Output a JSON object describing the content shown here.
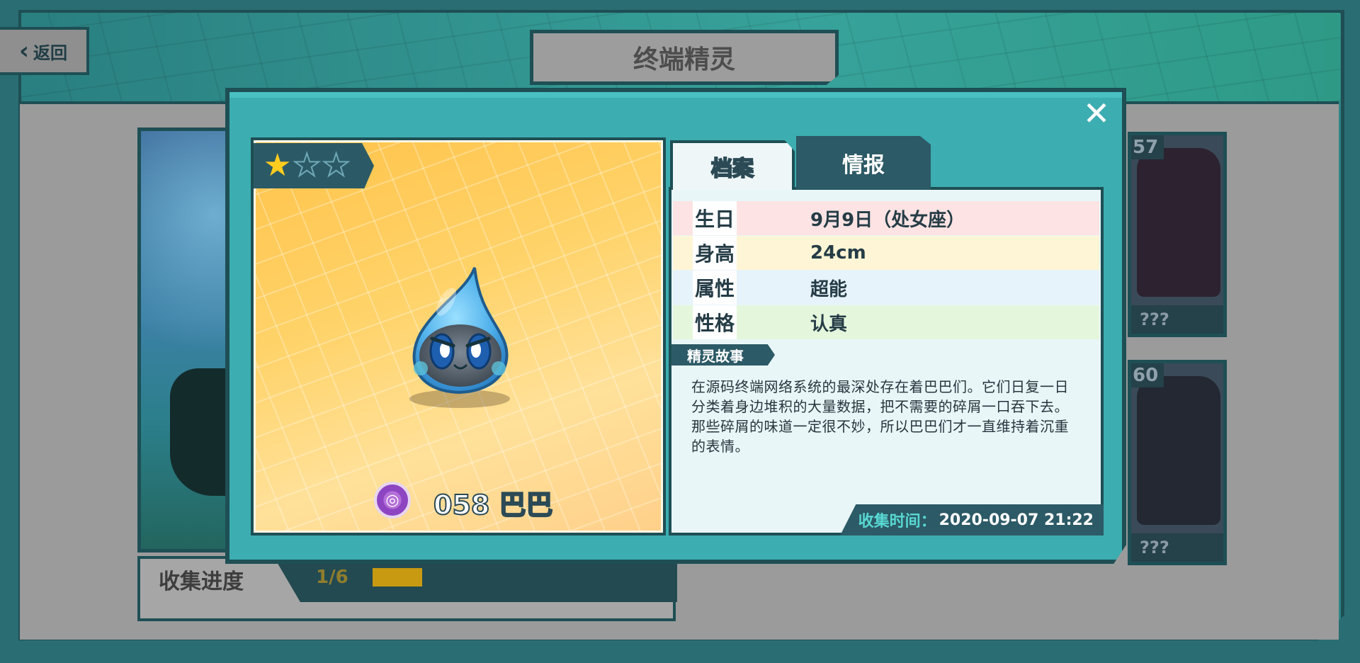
{
  "header": {
    "back_label": "返回",
    "title": "终端精灵"
  },
  "collection": {
    "progress_label": "收集进度",
    "progress_count": "1/6",
    "progress_fraction": 0.1667
  },
  "side_cards": [
    {
      "number": "57",
      "name": "???"
    },
    {
      "number": "60",
      "name": "???"
    }
  ],
  "modal": {
    "close_icon": "close-icon",
    "stars": {
      "filled": 1,
      "total": 3
    },
    "creature": {
      "number_name": "058 巴巴",
      "element_icon": "psychic-element-icon",
      "element_color": "#9b55cc"
    },
    "tabs": [
      {
        "label": "档案",
        "active": true
      },
      {
        "label": "情报",
        "active": false
      }
    ],
    "profile": [
      {
        "key": "生日",
        "value": "9月9日（处女座）",
        "color": "#fde3e3"
      },
      {
        "key": "身高",
        "value": "24cm",
        "color": "#fdf5d5"
      },
      {
        "key": "属性",
        "value": "超能",
        "color": "#e6f3fb"
      },
      {
        "key": "性格",
        "value": "认真",
        "color": "#e4f7dc"
      }
    ],
    "story_title": "精灵故事",
    "story_text": "在源码终端网络系统的最深处存在着巴巴们。它们日复一日分类着身边堆积的大量数据，把不需要的碎屑一口吞下去。那些碎屑的味道一定很不妙，所以巴巴们才一直维持着沉重的表情。",
    "collect_time_label": "收集时间：",
    "collect_time_value": "2020-09-07 21:22"
  }
}
